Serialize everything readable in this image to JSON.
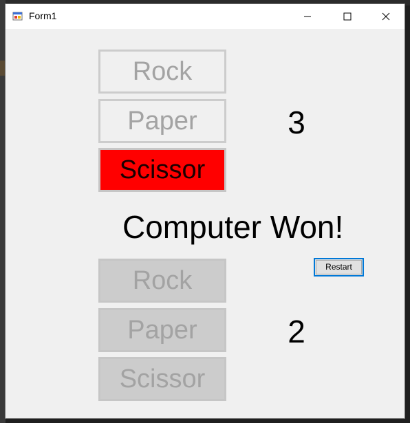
{
  "window": {
    "title": "Form1"
  },
  "player": {
    "buttons": [
      "Rock",
      "Paper",
      "Scissor"
    ],
    "score": "3"
  },
  "computer": {
    "buttons": [
      "Rock",
      "Paper",
      "Scissor"
    ],
    "score": "2"
  },
  "result_text": "Computer Won!",
  "restart_label": "Restart",
  "colors": {
    "selected_choice": "#ff0000",
    "restart_border": "#0078d7",
    "window_bg": "#f0f0f0"
  },
  "icons": {
    "app": "winforms-app-icon",
    "minimize": "minimize-icon",
    "maximize": "maximize-icon",
    "close": "close-icon"
  }
}
